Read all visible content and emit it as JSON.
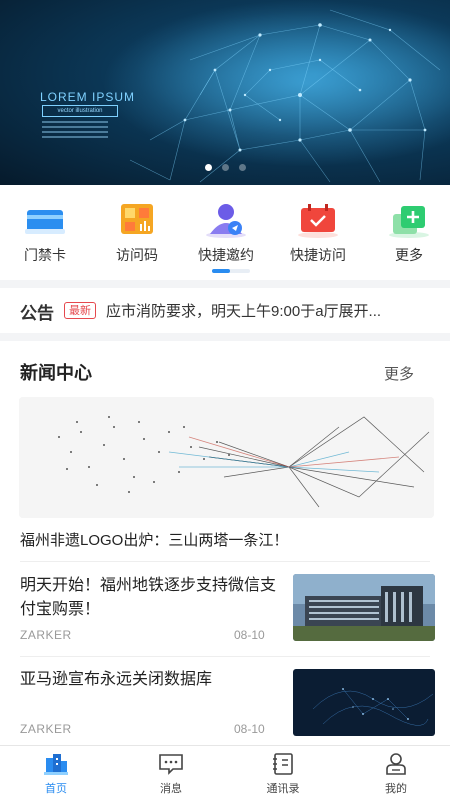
{
  "banner": {
    "title": "LOREM IPSUM",
    "subtitle": "vector illustration",
    "slides": 3,
    "active_slide": 0
  },
  "quick_actions": [
    {
      "label": "门禁卡",
      "icon": "access-card-icon",
      "color": "#2b8ef0"
    },
    {
      "label": "访问码",
      "icon": "access-code-icon",
      "color": "#f39c12"
    },
    {
      "label": "快捷邀约",
      "icon": "quick-invite-icon",
      "color": "#6c5ce7"
    },
    {
      "label": "快捷访问",
      "icon": "quick-visit-icon",
      "color": "#e74c3c"
    },
    {
      "label": "更多",
      "icon": "more-plus-icon",
      "color": "#2ecc71"
    }
  ],
  "notice": {
    "title": "公告",
    "badge": "最新",
    "text": "应市消防要求，明天上午9:00于a厅展开..."
  },
  "news": {
    "heading": "新闻中心",
    "more_label": "更多",
    "featured_title": "福州非遗LOGO出炉：三山两塔一条江！",
    "items": [
      {
        "title": "明天开始！福州地铁逐步支持微信支付宝购票！",
        "source": "ZARKER",
        "date": "08-10"
      },
      {
        "title": "亚马逊宣布永远关闭数据库",
        "source": "ZARKER",
        "date": "08-10"
      }
    ]
  },
  "tabs": [
    {
      "label": "首页",
      "icon": "home-icon",
      "active": true
    },
    {
      "label": "消息",
      "icon": "message-icon",
      "active": false
    },
    {
      "label": "通讯录",
      "icon": "contacts-icon",
      "active": false
    },
    {
      "label": "我的",
      "icon": "profile-icon",
      "active": false
    }
  ],
  "colors": {
    "accent": "#2a8cf0",
    "badge": "#e5484d"
  }
}
